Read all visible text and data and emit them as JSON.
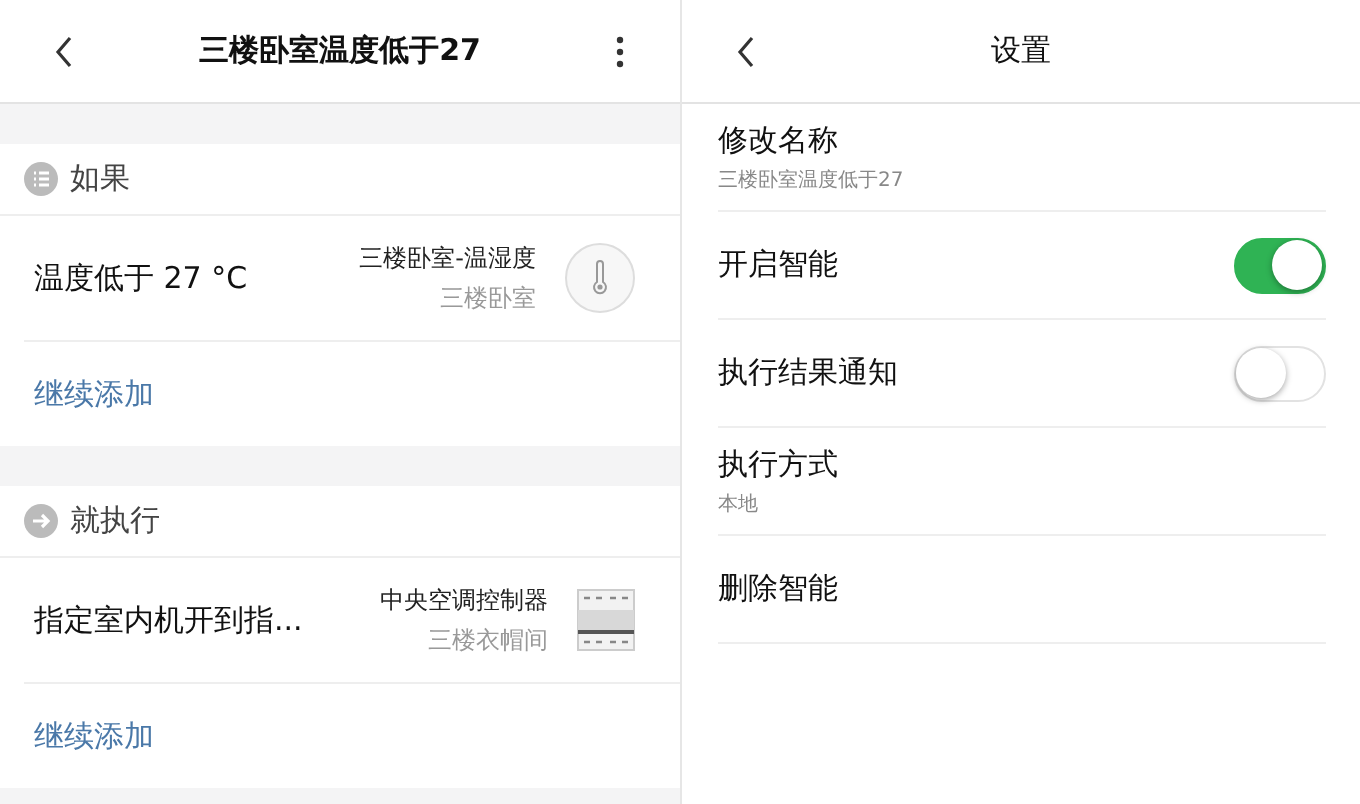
{
  "scene_page": {
    "title": "三楼卧室温度低于27",
    "sections": [
      {
        "kind": "condition",
        "label": "如果",
        "rows": [
          {
            "text": "温度低于 27 °C",
            "device": "三楼卧室-温湿度",
            "room": "三楼卧室"
          }
        ],
        "add_link": "继续添加"
      },
      {
        "kind": "action",
        "label": "就执行",
        "rows": [
          {
            "text": "指定室内机开到指...",
            "device": "中央空调控制器",
            "room": "三楼衣帽间"
          }
        ],
        "add_link": "继续添加"
      }
    ]
  },
  "settings_page": {
    "title": "设置",
    "items": [
      {
        "kind": "info",
        "label": "修改名称",
        "subtitle": "三楼卧室温度低于27"
      },
      {
        "kind": "toggle",
        "label": "开启智能",
        "on": true
      },
      {
        "kind": "toggle",
        "label": "执行结果通知",
        "on": false
      },
      {
        "kind": "info",
        "label": "执行方式",
        "subtitle": "本地"
      },
      {
        "kind": "action",
        "label": "删除智能"
      }
    ]
  }
}
